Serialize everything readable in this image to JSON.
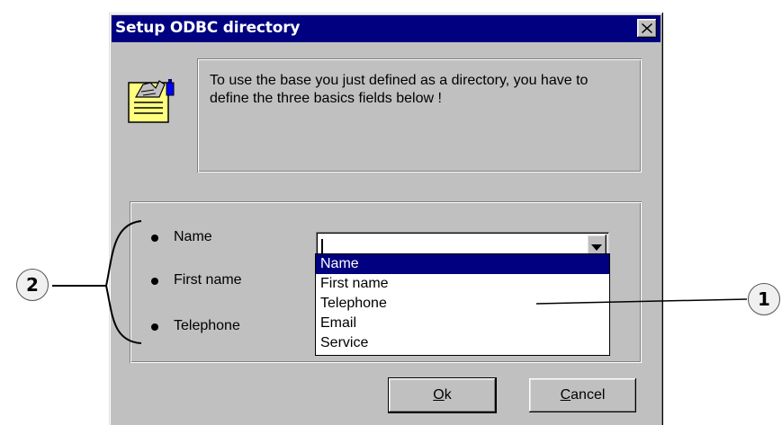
{
  "dialog": {
    "title": "Setup ODBC directory",
    "close_icon": "close-icon",
    "info_icon": "directory-card-icon",
    "message": "To use the base you just defined as a directory, you have to define the three basics fields below !"
  },
  "fields": [
    {
      "label": "Name"
    },
    {
      "label": "First name"
    },
    {
      "label": "Telephone"
    }
  ],
  "combo": {
    "value": "",
    "dropdown_icon": "chevron-down-icon",
    "options": [
      "Name",
      "First name",
      "Telephone",
      "Email",
      "Service"
    ],
    "highlighted": "Name"
  },
  "buttons": {
    "ok": "Ok",
    "cancel": "Cancel"
  },
  "callouts": {
    "left": "2",
    "right": "1"
  },
  "colors": {
    "titlebar": "#000080",
    "dialog_face": "#c0c0c0",
    "selection": "#000080"
  }
}
